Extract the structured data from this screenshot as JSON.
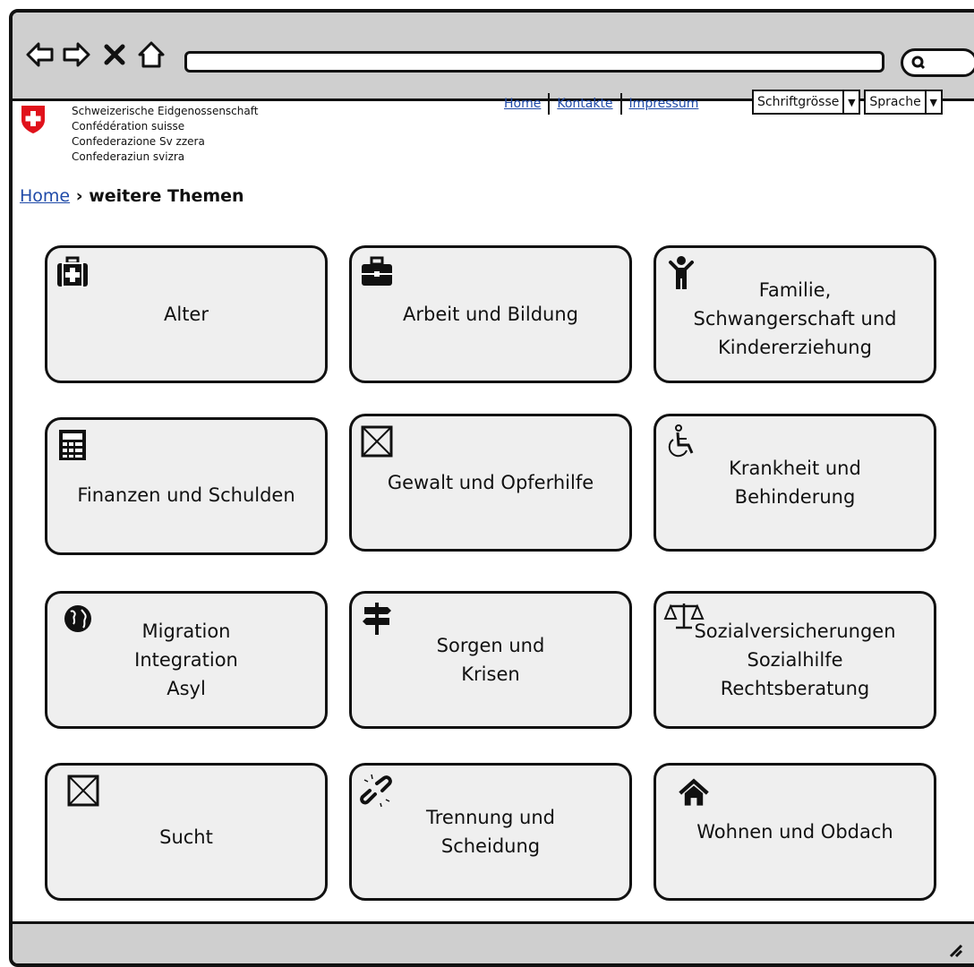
{
  "browser": {
    "icons": [
      "back-arrow-icon",
      "forward-arrow-icon",
      "close-icon",
      "home-icon"
    ],
    "search_icon": "search-icon"
  },
  "header": {
    "org_lines": [
      "Schweizerische Eidgenossenschaft",
      "Confédération suisse",
      "Confederazione Sv zzera",
      "Confederaziun svizra"
    ],
    "nav": [
      "Home",
      "Kontakte",
      "Impressum"
    ],
    "font_size_label": "Schriftgrösse",
    "language_label": "Sprache"
  },
  "breadcrumb": {
    "home": "Home",
    "separator": "›",
    "current": "weitere Themen"
  },
  "tiles": [
    {
      "label": "Alter",
      "icon": "medical-kit-icon"
    },
    {
      "label": "Arbeit und Bildung",
      "icon": "briefcase-icon"
    },
    {
      "label": "Familie,\nSchwangerschaft und\nKindererziehung",
      "icon": "child-icon"
    },
    {
      "label": "Finanzen und Schulden",
      "icon": "calculator-icon"
    },
    {
      "label": "Gewalt und Opferhilfe",
      "icon": "image-placeholder-icon"
    },
    {
      "label": "Krankheit und\nBehinderung",
      "icon": "wheelchair-icon"
    },
    {
      "label": "Migration\nIntegration\nAsyl",
      "icon": "globe-icon"
    },
    {
      "label": "Sorgen und\nKrisen",
      "icon": "signpost-icon"
    },
    {
      "label": "Sozialversicherungen\nSozialhilfe\nRechtsberatung",
      "icon": "balance-scale-icon"
    },
    {
      "label": "Sucht",
      "icon": "image-placeholder-icon"
    },
    {
      "label": "Trennung und\nScheidung",
      "icon": "broken-link-icon"
    },
    {
      "label": "Wohnen und Obdach",
      "icon": "house-icon"
    }
  ]
}
